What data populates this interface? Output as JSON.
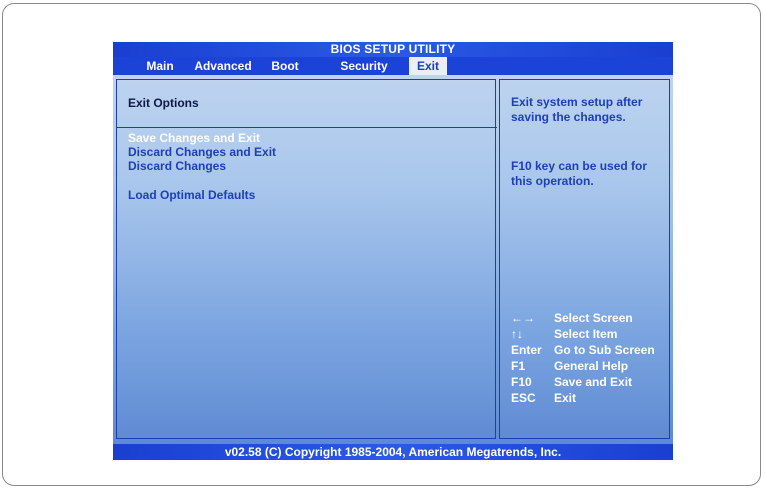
{
  "title": "BIOS SETUP UTILITY",
  "tabs": [
    {
      "label": "Main"
    },
    {
      "label": "Advanced"
    },
    {
      "label": "Boot"
    },
    {
      "label": "Security"
    },
    {
      "label": "Exit",
      "active": true
    }
  ],
  "left": {
    "section_title": "Exit Options",
    "items": [
      {
        "label": "Save Changes and Exit",
        "selected": true
      },
      {
        "label": "Discard Changes and Exit"
      },
      {
        "label": "Discard Changes"
      },
      {
        "label": "Load Optimal Defaults"
      }
    ]
  },
  "help": {
    "line1": "Exit system setup after saving the changes.",
    "line2": "F10 key can be used for this operation."
  },
  "keys": [
    {
      "key": "←→",
      "desc": "Select Screen"
    },
    {
      "key": "↑↓",
      "desc": "Select Item"
    },
    {
      "key": "Enter",
      "desc": "Go to Sub Screen"
    },
    {
      "key": "F1",
      "desc": "General Help"
    },
    {
      "key": "F10",
      "desc": "Save and Exit"
    },
    {
      "key": "ESC",
      "desc": "Exit"
    }
  ],
  "footer": "v02.58 (C) Copyright  1985-2004, American Megatrends, Inc.",
  "colors": {
    "bar_blue": "#1c43d8",
    "panel_border": "#1c3fb0",
    "text_blue": "#1d3fb8",
    "highlight_text": "#ffffff"
  }
}
